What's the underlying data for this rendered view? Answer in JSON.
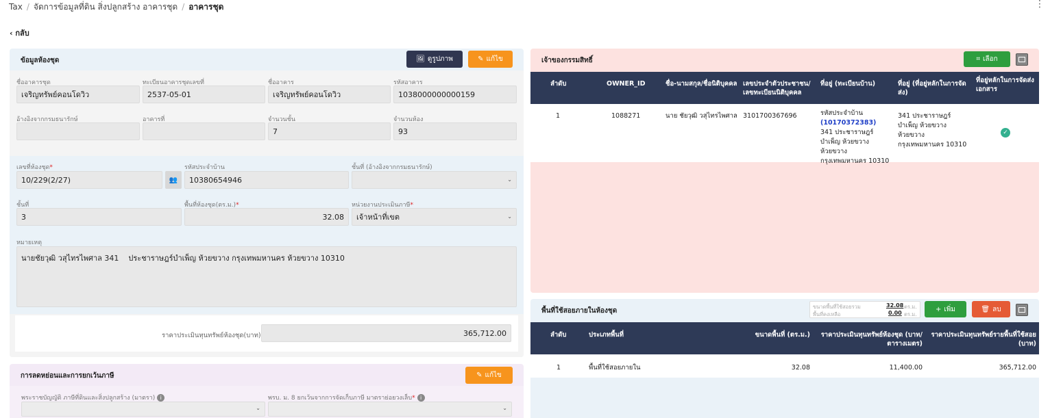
{
  "breadcrumb": {
    "items": [
      "Tax",
      "จัดการข้อมูลที่ดิน สิ่งปลูกสร้าง อาคารชุด",
      "อาคารชุด"
    ]
  },
  "back_label": "กลับ",
  "unit_info": {
    "title": "ข้อมูลห้องชุด",
    "view_image_label": "ดูรูปภาพ",
    "edit_label": "แก้ไข",
    "fields": {
      "building_name": {
        "label": "ชื่ออาคารชุด",
        "value": "เจริญทรัพย์คอนโดวิว"
      },
      "registration_no": {
        "label": "ทะเบียนอาคารชุดเลขที่",
        "value": "2537-05-01"
      },
      "building": {
        "label": "ชื่ออาคาร",
        "value": "เจริญทรัพย์คอนโดวิว"
      },
      "building_code": {
        "label": "รหัสอาคาร",
        "value": "1038000000000159"
      },
      "treasury_ref": {
        "label": "อ้างอิงจากกรมธนารักษ์",
        "value": ""
      },
      "building_no": {
        "label": "อาคารที่",
        "value": ""
      },
      "floors": {
        "label": "จำนวนชั้น",
        "value": "7"
      },
      "rooms": {
        "label": "จำนวนห้อง",
        "value": "93"
      },
      "room_no": {
        "label": "เลขที่ห้องชุด",
        "value": "10/229(2/27)"
      },
      "house_code": {
        "label": "รหัสประจำบ้าน",
        "value": "10380654946"
      },
      "floor_treasury": {
        "label": "ชั้นที่ (อ้างอิงจากกรมธนารักษ์)",
        "value": ""
      },
      "floor": {
        "label": "ชั้นที่",
        "value": "3"
      },
      "area": {
        "label": "พื้นที่ห้องชุด(ตร.ม.)",
        "value": "32.08"
      },
      "assessor": {
        "label": "หน่วยงานประเมินภาษี",
        "value": "เจ้าหน้าที่เขต"
      },
      "remark": {
        "label": "หมายเหตุ",
        "value": "นายชัยวุฒิ วสุไทรไพศาล 341    ประชาราษฎร์บำเพ็ญ ห้วยขวาง กรุงเทพมหานคร ห้วยขวาง 10310"
      }
    },
    "appraisal_label": "ราคาประเมินทุนทรัพย์ห้องชุด(บาท)",
    "appraisal_value": "365,712.00"
  },
  "tax_relief": {
    "title": "การลดหย่อนและการยกเว้นภาษี",
    "edit_label": "แก้ไข",
    "act_label": "พระราชบัญญัติ ภาษีที่ดินและสิ่งปลูกสร้าง (มาตรา)",
    "exempt_label": "พรบ. ม. 8 ยกเว้นจากการจัดเก็บภาษี มาตราย่อยวงเล็บ"
  },
  "owners": {
    "title": "เจ้าของกรรมสิทธิ์",
    "select_label": "เลือก",
    "columns": [
      "ลำดับ",
      "OWNER_ID",
      "ชื่อ-นามสกุล/ชื่อนิติบุคคล",
      "เลขประจำตัวประชาชน/ เลขทะเบียนนิติบุคคล",
      "ที่อยู่ (ทะเบียนบ้าน)",
      "ที่อยู่ (ที่อยู่หลักในการจัดส่ง)",
      "ที่อยู่หลักในการจัดส่งเอกสาร"
    ],
    "rows": [
      {
        "no": "1",
        "owner_id": "1088271",
        "name": "นาย ชัยวุฒิ วสุไทรไพศาล",
        "citizen_id": "3101700367696",
        "house_code_label": "รหัสประจำบ้าน",
        "house_code": "(10170372383)",
        "address": "341 ประชาราษฎร์บำเพ็ญ ห้วยขวาง ห้วยขวาง กรุงเทพมหานคร 10310",
        "mail_address": "341 ประชาราษฎร์บำเพ็ญ ห้วยขวาง ห้วยขวาง กรุงเทพมหานคร 10310"
      }
    ]
  },
  "usage": {
    "title": "พื้นที่ใช้สอยภายในห้องชุด",
    "summary_label1": "ขนาดพื้นที่ใช้สอยรวม",
    "summary_value1": "32.08",
    "summary_label2": "พื้นที่คงเหลือ",
    "summary_value2": "0.00",
    "unit": "ตร.ม.",
    "add_label": "เพิ่ม",
    "delete_label": "ลบ",
    "columns": [
      "ลำดับ",
      "ประเภทพื้นที่",
      "ขนาดพื้นที่ (ตร.ม.)",
      "ราคาประเมินทุนทรัพย์ห้องชุด (บาท/ ตารางเมตร)",
      "ราคาประเมินทุนทรัพย์รายพื้นที่ใช้สอย (บาท)"
    ],
    "rows": [
      {
        "no": "1",
        "type": "พื้นที่ใช้สอยภายใน",
        "area": "32.08",
        "price_per_sqm": "11,400.00",
        "total": "365,712.00"
      }
    ]
  },
  "colors": {
    "table_header": "#2e3a57",
    "owner_panel_bg": "#fde2e0",
    "unit_panel_bg": "#eaf2f8",
    "relief_panel_bg": "#f3eaf6",
    "orange": "#f7941d",
    "green": "#2e9e3e",
    "red": "#e55b36"
  }
}
